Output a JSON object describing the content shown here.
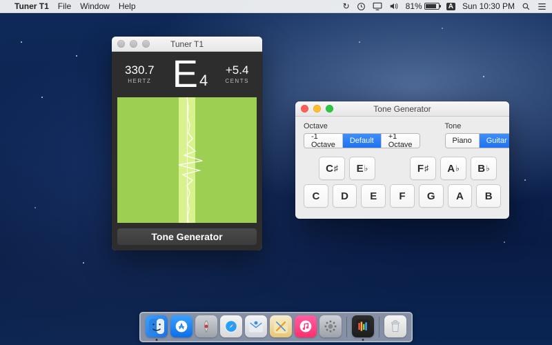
{
  "menubar": {
    "app_name": "Tuner T1",
    "items": [
      "File",
      "Window",
      "Help"
    ],
    "battery_pct": "81%",
    "lang": "A",
    "clock": "Sun 10:30 PM"
  },
  "tuner": {
    "window_title": "Tuner T1",
    "hertz_value": "330.7",
    "hertz_label": "HERTZ",
    "note": "E",
    "note_octave": "4",
    "cents_value": "+5.4",
    "cents_label": "CENTS",
    "button_label": "Tone Generator"
  },
  "tone_generator": {
    "window_title": "Tone Generator",
    "octave": {
      "label": "Octave",
      "options": [
        "-1 Octave",
        "Default",
        "+1 Octave"
      ],
      "selected": "Default"
    },
    "tone": {
      "label": "Tone",
      "options": [
        "Piano",
        "Guitar"
      ],
      "selected": "Guitar"
    },
    "sharps_row": [
      "C♯",
      "E♭",
      "",
      "F♯",
      "A♭",
      "B♭"
    ],
    "naturals_row": [
      "C",
      "D",
      "E",
      "F",
      "G",
      "A",
      "B"
    ]
  },
  "dock": {
    "apps": [
      {
        "name": "finder",
        "bg": "linear-gradient(135deg,#39a0ff,#1c6fe0)",
        "running": true
      },
      {
        "name": "app-store",
        "bg": "linear-gradient(#3aa1ff,#0c6fe8)"
      },
      {
        "name": "launchpad",
        "bg": "linear-gradient(#cfd3d8,#9da2a9)"
      },
      {
        "name": "safari",
        "bg": "linear-gradient(#f4f4f4,#d9d9d9)"
      },
      {
        "name": "mail",
        "bg": "linear-gradient(#f5f5f7,#d0d4da)"
      },
      {
        "name": "maps",
        "bg": "linear-gradient(#f8ecd0,#e7c574)"
      },
      {
        "name": "itunes",
        "bg": "linear-gradient(#ff5fa2,#ff2e6e)"
      },
      {
        "name": "preferences",
        "bg": "linear-gradient(#cfd3d8,#9da2a9)"
      },
      {
        "name": "tuner-t1",
        "bg": "linear-gradient(#2d2d2d,#1e1e1e)",
        "running": true
      }
    ]
  }
}
